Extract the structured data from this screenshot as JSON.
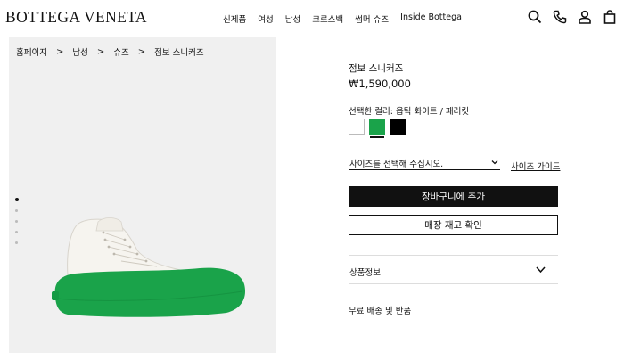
{
  "header": {
    "logo": "BOTTEGA VENETA",
    "nav": [
      "신제품",
      "여성",
      "남성",
      "크로스백",
      "썸머 슈즈",
      "Inside Bottega"
    ],
    "icons": [
      "search-icon",
      "phone-icon",
      "account-icon",
      "shopping-bag-icon"
    ]
  },
  "breadcrumb": [
    "홈페이지",
    "남성",
    "슈즈",
    "점보 스니커즈"
  ],
  "breadcrumb_separator": ">",
  "gallery": {
    "image_count": 5,
    "active_index": 0
  },
  "product": {
    "title": "점보 스니커즈",
    "price": "₩1,590,000",
    "color_label": "선택한 컬러: 옵틱 화이트 / 패러킷",
    "swatches": [
      {
        "name": "white",
        "color": "#ffffff"
      },
      {
        "name": "green",
        "color": "#1aa34a",
        "selected": true
      },
      {
        "name": "black",
        "color": "#000000"
      }
    ],
    "size_placeholder": "사이즈를 선택해 주십시오.",
    "size_guide": "사이즈 가이드",
    "add_to_cart": "장바구니에 추가",
    "store_stock": "매장 재고 확인",
    "product_info": "상품정보",
    "shipping": "무료 배송 및 반품"
  },
  "colors": {
    "accent_green": "#1aa34a",
    "text": "#111111",
    "gallery_bg": "#f0f0f0"
  }
}
